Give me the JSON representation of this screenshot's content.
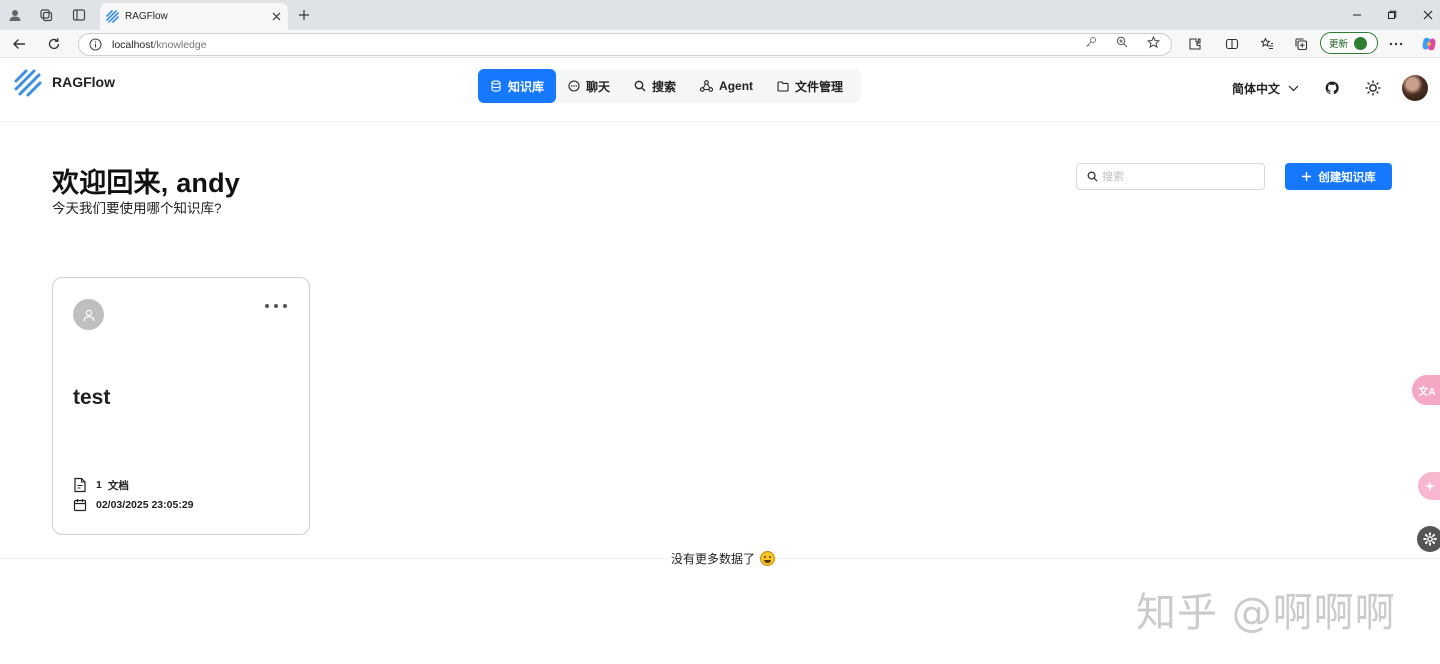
{
  "browser": {
    "tab_title": "RAGFlow",
    "url_host": "localhost",
    "url_path": "/knowledge",
    "update_label": "更新"
  },
  "app": {
    "name": "RAGFlow",
    "nav": [
      {
        "label": "知识库",
        "icon": "database-icon",
        "active": true
      },
      {
        "label": "聊天",
        "icon": "chat-icon",
        "active": false
      },
      {
        "label": "搜索",
        "icon": "search-icon",
        "active": false
      },
      {
        "label": "Agent",
        "icon": "agent-graph-icon",
        "active": false
      },
      {
        "label": "文件管理",
        "icon": "folder-icon",
        "active": false
      }
    ],
    "language": "简体中文",
    "accent_color": "#1677ff"
  },
  "page": {
    "welcome": "欢迎回来, andy",
    "subtitle": "今天我们要使用哪个知识库?",
    "search_placeholder": "搜索",
    "create_button": "创建知识库",
    "no_more": "没有更多数据了"
  },
  "knowledge_bases": [
    {
      "name": "test",
      "doc_count": "1",
      "doc_unit": "文档",
      "updated": "02/03/2025 23:05:29"
    }
  ],
  "overlay": {
    "watermark": "知乎 @啊啊啊",
    "translate_label": "文A"
  }
}
